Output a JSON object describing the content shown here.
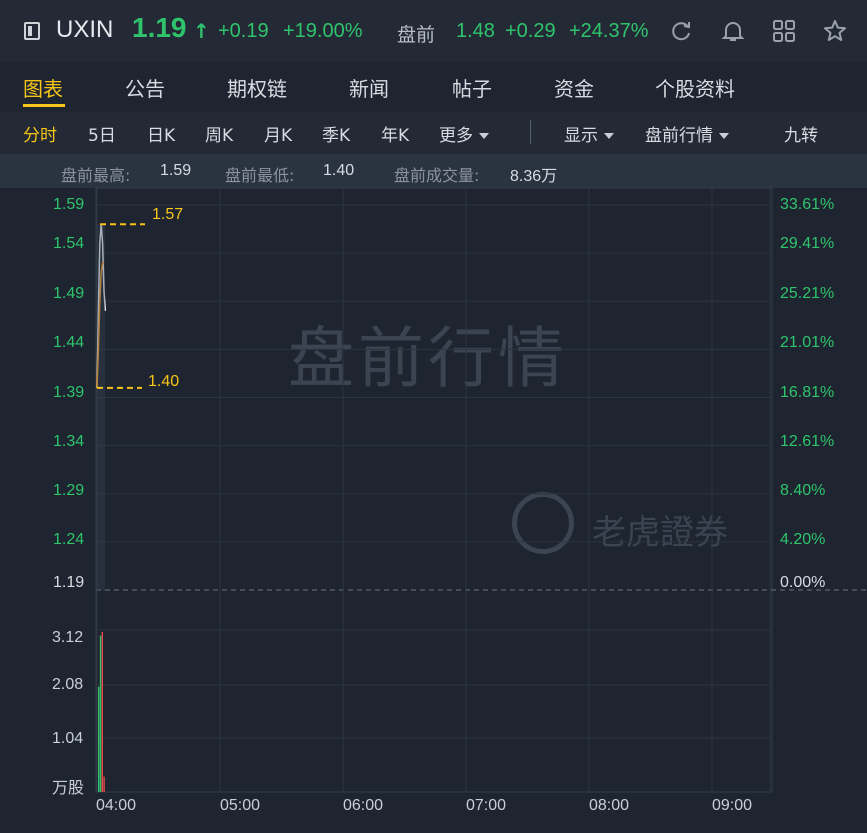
{
  "quote": {
    "ticker": "UXIN",
    "price": "1.19",
    "change": "+0.19",
    "change_pct": "+19.00%",
    "premarket_label": "盘前",
    "premarket_price": "1.48",
    "premarket_change": "+0.29",
    "premarket_change_pct": "+24.37%"
  },
  "header_icons": [
    "refresh-icon",
    "bell-icon",
    "grid-icon",
    "star-icon"
  ],
  "tabs": [
    "图表",
    "公告",
    "期权链",
    "新闻",
    "帖子",
    "资金",
    "个股资料"
  ],
  "active_tab": "图表",
  "periods": {
    "intraday": "分时",
    "five_day": "5日",
    "day_k": "日K",
    "week_k": "周K",
    "month_k": "月K",
    "quarter_k": "季K",
    "year_k": "年K",
    "more": "更多",
    "display": "显示",
    "premarket_quote": "盘前行情",
    "nine_turn": "九转"
  },
  "stats": {
    "high_label": "盘前最高:",
    "high_value": "1.59",
    "low_label": "盘前最低:",
    "low_value": "1.40",
    "volume_label": "盘前成交量:",
    "volume_value": "8.36万"
  },
  "chart": {
    "watermark": "盘前行情",
    "brand_watermark": "老虎證券",
    "max_marker": "1.57",
    "min_marker": "1.40",
    "volume_unit": "万股",
    "colors": {
      "up": "#2fc46c",
      "down": "#e84a4a",
      "marker": "#f5c518",
      "avg_line": "#f0a030",
      "price_line": "#e6e9ee"
    }
  },
  "chart_data": {
    "type": "line",
    "y_price_ticks": [
      "1.59",
      "1.54",
      "1.49",
      "1.44",
      "1.39",
      "1.34",
      "1.29",
      "1.24",
      "1.19"
    ],
    "y_pct_ticks": [
      "33.61%",
      "29.41%",
      "25.21%",
      "21.01%",
      "16.81%",
      "12.61%",
      "8.40%",
      "4.20%",
      "0.00%"
    ],
    "x_ticks": [
      "04:00",
      "05:00",
      "06:00",
      "07:00",
      "08:00",
      "09:00"
    ],
    "volume_ticks": [
      "3.12",
      "2.08",
      "1.04"
    ],
    "ylim": [
      1.19,
      1.59
    ],
    "series": [
      {
        "values": [
          1.4,
          1.48,
          1.55,
          1.57,
          1.55,
          1.5,
          1.48
        ]
      },
      {
        "values": [
          1.4,
          1.44,
          1.49,
          1.52,
          1.53,
          1.53
        ]
      }
    ],
    "volume": [
      {
        "value": 2.05,
        "color": "green"
      },
      {
        "value": 3.05,
        "color": "green"
      },
      {
        "value": 3.12,
        "color": "red"
      },
      {
        "value": 0.3,
        "color": "red"
      }
    ]
  }
}
